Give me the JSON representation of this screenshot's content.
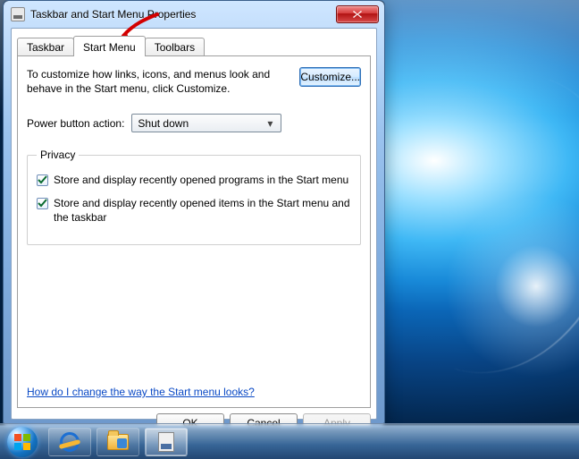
{
  "window": {
    "title": "Taskbar and Start Menu Properties"
  },
  "tabs": {
    "taskbar": "Taskbar",
    "start_menu": "Start Menu",
    "toolbars": "Toolbars",
    "active": "start_menu"
  },
  "panel": {
    "description": "To customize how links, icons, and menus look and behave in the Start menu, click Customize.",
    "customize_label": "Customize...",
    "power_label": "Power button action:",
    "power_value": "Shut down",
    "privacy_legend": "Privacy",
    "privacy_opt1": "Store and display recently opened programs in the Start menu",
    "privacy_opt1_checked": true,
    "privacy_opt2": "Store and display recently opened items in the Start menu and the taskbar",
    "privacy_opt2_checked": true,
    "help_link": "How do I change the way the Start menu looks?"
  },
  "buttons": {
    "ok": "OK",
    "cancel": "Cancel",
    "apply": "Apply"
  },
  "taskbar_items": {
    "start": "start-button",
    "ie": "internet-explorer",
    "explorer": "file-explorer",
    "props": "taskbar-properties"
  },
  "annotation": {
    "arrow_target": "Start Menu tab"
  }
}
